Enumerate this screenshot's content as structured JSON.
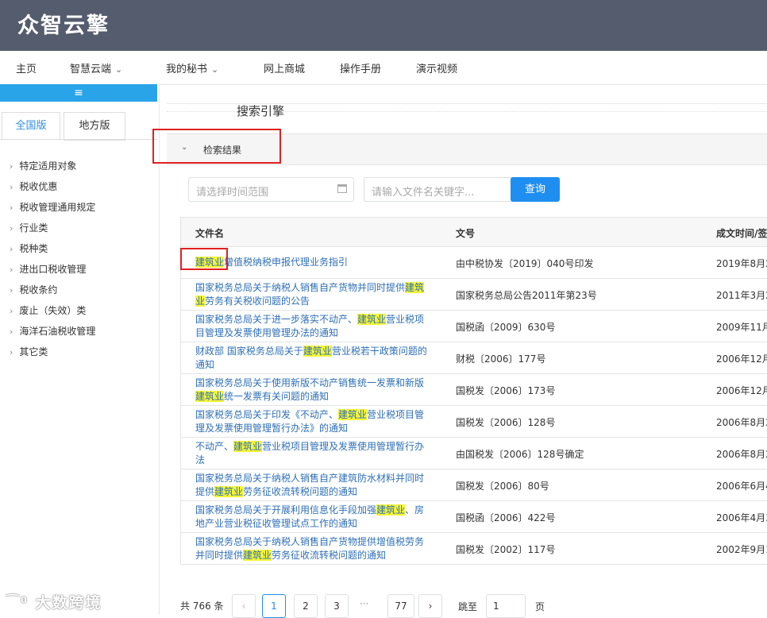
{
  "app": {
    "logo": "众智云擎"
  },
  "nav": {
    "items": [
      {
        "label": "主页"
      },
      {
        "label": "智慧云端",
        "dropdown": true
      },
      {
        "label": "我的秘书",
        "dropdown": true
      },
      {
        "label": "网上商城"
      },
      {
        "label": "操作手册"
      },
      {
        "label": "演示视频"
      }
    ]
  },
  "sidebar": {
    "toggle_icon": "≡",
    "tabs": [
      {
        "label": "全国版",
        "active": true
      },
      {
        "label": "地方版",
        "active": false
      }
    ],
    "items": [
      {
        "label": "特定适用对象"
      },
      {
        "label": "税收优惠"
      },
      {
        "label": "税收管理通用规定"
      },
      {
        "label": "行业类"
      },
      {
        "label": "税种类"
      },
      {
        "label": "进出口税收管理"
      },
      {
        "label": "税收条约"
      },
      {
        "label": "废止（失效）类"
      },
      {
        "label": "海洋石油税收管理"
      },
      {
        "label": "其它类"
      }
    ]
  },
  "main": {
    "section_title": "搜索引擎",
    "result_label": "检索结果",
    "date_placeholder": "请选择时间范围",
    "keyword_placeholder": "请输入文件名关键字...",
    "query_button": "查询",
    "columns": [
      "文件名",
      "文号",
      "成文时间/签"
    ],
    "highlight_word": "建筑业",
    "rows": [
      {
        "parts": [
          {
            "t": "建筑业",
            "h": true
          },
          {
            "t": "增值税纳税申报代理业务指引"
          }
        ],
        "num": "由中税协发〔2019〕040号印发",
        "date": "2019年8月2"
      },
      {
        "parts": [
          {
            "t": "国家税务总局关于纳税人销售自产货物并同时提供"
          },
          {
            "t": "建筑业",
            "h": true
          },
          {
            "t": "劳务有关税收问题的公告"
          }
        ],
        "num": "国家税务总局公告2011年第23号",
        "date": "2011年3月2"
      },
      {
        "parts": [
          {
            "t": "国家税务总局关于进一步落实不动产、"
          },
          {
            "t": "建筑业",
            "h": true
          },
          {
            "t": "营业税项目管理及发票使用管理办法的通知"
          }
        ],
        "num": "国税函〔2009〕630号",
        "date": "2009年11月"
      },
      {
        "parts": [
          {
            "t": "财政部 国家税务总局关于"
          },
          {
            "t": "建筑业",
            "h": true
          },
          {
            "t": "营业税若干政策问题的通知"
          }
        ],
        "num": "财税〔2006〕177号",
        "date": "2006年12月"
      },
      {
        "parts": [
          {
            "t": "国家税务总局关于使用新版不动产销售统一发票和新版"
          },
          {
            "t": "建筑业",
            "h": true
          },
          {
            "t": "统一发票有关问题的通知"
          }
        ],
        "num": "国税发〔2006〕173号",
        "date": "2006年12月"
      },
      {
        "parts": [
          {
            "t": "国家税务总局关于印发《不动产、"
          },
          {
            "t": "建筑业",
            "h": true
          },
          {
            "t": "营业税项目管理及发票使用管理暂行办法》的通知"
          }
        ],
        "num": "国税发〔2006〕128号",
        "date": "2006年8月2"
      },
      {
        "parts": [
          {
            "t": "不动产、"
          },
          {
            "t": "建筑业",
            "h": true
          },
          {
            "t": "营业税项目管理及发票使用管理暂行办法"
          }
        ],
        "num": "由国税发〔2006〕128号确定",
        "date": "2006年8月2"
      },
      {
        "parts": [
          {
            "t": "国家税务总局关于纳税人销售自产建筑防水材料并同时提供"
          },
          {
            "t": "建筑业",
            "h": true
          },
          {
            "t": "劳务征收流转税问题的通知"
          }
        ],
        "num": "国税发〔2006〕80号",
        "date": "2006年6月4"
      },
      {
        "parts": [
          {
            "t": "国家税务总局关于开展利用信息化手段加强"
          },
          {
            "t": "建筑业",
            "h": true
          },
          {
            "t": "、房地产业营业税征收管理试点工作的通知"
          }
        ],
        "num": "国税函〔2006〕422号",
        "date": "2006年4月3"
      },
      {
        "parts": [
          {
            "t": "国家税务总局关于纳税人销售自产货物提供增值税劳务并同时提供"
          },
          {
            "t": "建筑业",
            "h": true
          },
          {
            "t": "劳务征收流转税问题的通知"
          }
        ],
        "num": "国税发〔2002〕117号",
        "date": "2002年9月1"
      }
    ],
    "pagination": {
      "total": "共 766 条",
      "prev": "‹",
      "pages": [
        "1",
        "2",
        "3"
      ],
      "ellipsis": "···",
      "last": "77",
      "next": "›",
      "current": "1",
      "jump_label": "跳至",
      "jump_value": "1",
      "page_unit": "页"
    }
  },
  "watermark": "大数跨境"
}
